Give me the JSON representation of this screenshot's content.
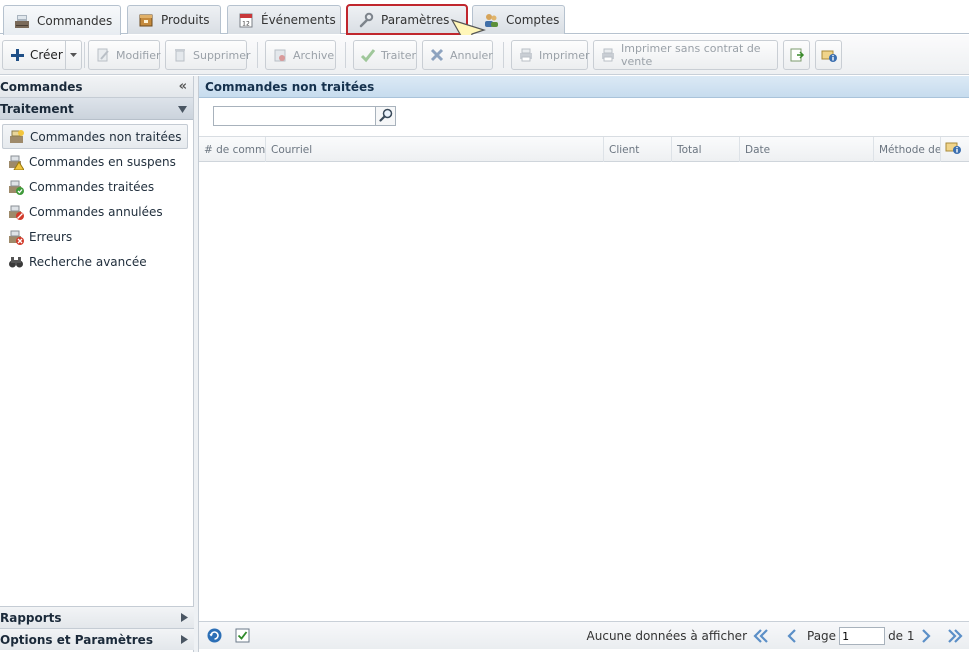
{
  "tabs": [
    {
      "label": "Commandes",
      "icon": "register-icon",
      "active": true
    },
    {
      "label": "Produits",
      "icon": "box-icon"
    },
    {
      "label": "Événements",
      "icon": "calendar-icon"
    },
    {
      "label": "Paramètres",
      "icon": "wrench-icon",
      "highlighted": true
    },
    {
      "label": "Comptes",
      "icon": "users-icon"
    }
  ],
  "toolbar": {
    "create": "Créer",
    "modify": "Modifier",
    "delete": "Supprimer",
    "archive": "Archive",
    "process": "Traiter",
    "cancel": "Annuler",
    "print": "Imprimer",
    "print_no_contract": "Imprimer sans contrat de vente"
  },
  "left": {
    "header": "Commandes",
    "section": "Traitement",
    "items": [
      {
        "label": "Commandes non traitées",
        "icon": "order-new-icon",
        "active": true
      },
      {
        "label": "Commandes en suspens",
        "icon": "order-pending-icon"
      },
      {
        "label": "Commandes traitées",
        "icon": "order-done-icon"
      },
      {
        "label": "Commandes annulées",
        "icon": "order-cancelled-icon"
      },
      {
        "label": "Erreurs",
        "icon": "error-icon"
      },
      {
        "label": "Recherche avancée",
        "icon": "binoculars-icon"
      }
    ],
    "reports": "Rapports",
    "options": "Options et Paramètres"
  },
  "main": {
    "title": "Commandes non traitées",
    "search_value": "",
    "columns": [
      "# de comma",
      "Courriel",
      "Client",
      "Total",
      "Date",
      "Méthode de"
    ],
    "empty_text": "Aucune données à afficher",
    "page_label": "Page",
    "page_value": "1",
    "of_label": "de 1"
  },
  "colors": {
    "highlight": "#c0262d",
    "title_bg": "#c7dcee"
  }
}
